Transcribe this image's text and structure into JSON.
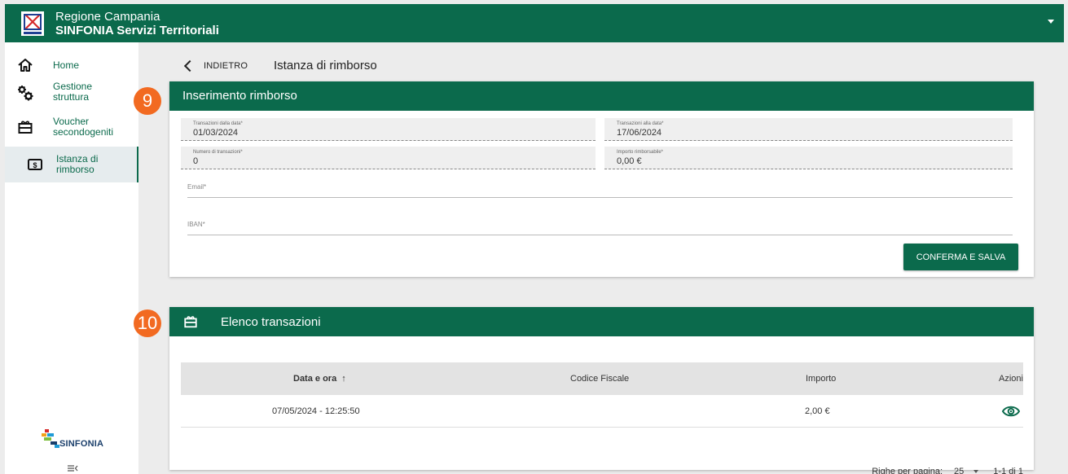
{
  "header": {
    "region": "Regione Campania",
    "app_name": "SINFONIA Servizi Territoriali",
    "menu_icon": "caret-down-icon",
    "brand_color": "#0b6a4c"
  },
  "sidebar": {
    "items": [
      {
        "label_line1": "Home",
        "label_line2": "",
        "icon": "home-icon",
        "active": false
      },
      {
        "label_line1": "Gestione",
        "label_line2": "struttura",
        "icon": "gears-icon",
        "active": false
      },
      {
        "label_line1": "Voucher",
        "label_line2": "secondogeniti",
        "icon": "gift-icon",
        "active": false
      },
      {
        "label_line1": "Istanza di",
        "label_line2": "rimborso",
        "icon": "money-icon",
        "active": true
      }
    ],
    "footer_logo": "SINFONIA",
    "collapse_icon": "collapse-menu-icon"
  },
  "page": {
    "back_label": "INDIETRO",
    "title": "Istanza di rimborso"
  },
  "form_card": {
    "badge": "9",
    "title": "Inserimento rimborso",
    "from_date": {
      "label": "Transazioni dalla data*",
      "value": "01/03/2024"
    },
    "to_date": {
      "label": "Transazioni alla data*",
      "value": "17/06/2024"
    },
    "num_transactions": {
      "label": "Numero di transazioni*",
      "value": "0"
    },
    "amount": {
      "label": "Importo rimborsabile*",
      "value": "0,00 €"
    },
    "email": {
      "label": "Email*",
      "value": ""
    },
    "iban": {
      "label": "IBAN*",
      "value": ""
    },
    "confirm_button": "CONFERMA E SALVA",
    "badge_color": "#f26a21"
  },
  "transactions_card": {
    "badge": "10",
    "title": "Elenco transazioni",
    "columns": {
      "date": "Data e ora",
      "sort_icon": "↑",
      "fiscal_code": "Codice Fiscale",
      "amount": "Importo",
      "actions": "Azioni"
    },
    "rows": [
      {
        "date": "07/05/2024 - 12:25:50",
        "fiscal_code": "",
        "amount": "2,00 €",
        "action_icon": "eye-icon"
      }
    ],
    "pagination": {
      "rows_per_page_label": "Righe per pagina:",
      "rows_per_page": "25",
      "range": "1-1 di 1"
    }
  }
}
